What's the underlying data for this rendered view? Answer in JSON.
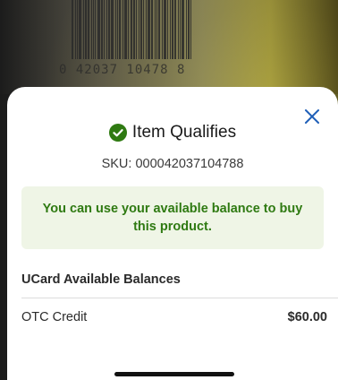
{
  "camera": {
    "barcode_digits": "0  42037 10478  8"
  },
  "result": {
    "status_icon": "check-circle-icon",
    "title": "Item Qualifies",
    "sku": "SKU: 000042037104788",
    "notice": "You can use your available balance to buy this product."
  },
  "balances": {
    "heading": "UCard Available Balances",
    "items": [
      {
        "label": "OTC Credit",
        "value": "$60.00"
      }
    ]
  },
  "colors": {
    "accent_green": "#2f7a12",
    "notice_bg": "#eff5e6",
    "close_blue": "#1f5fb8"
  }
}
